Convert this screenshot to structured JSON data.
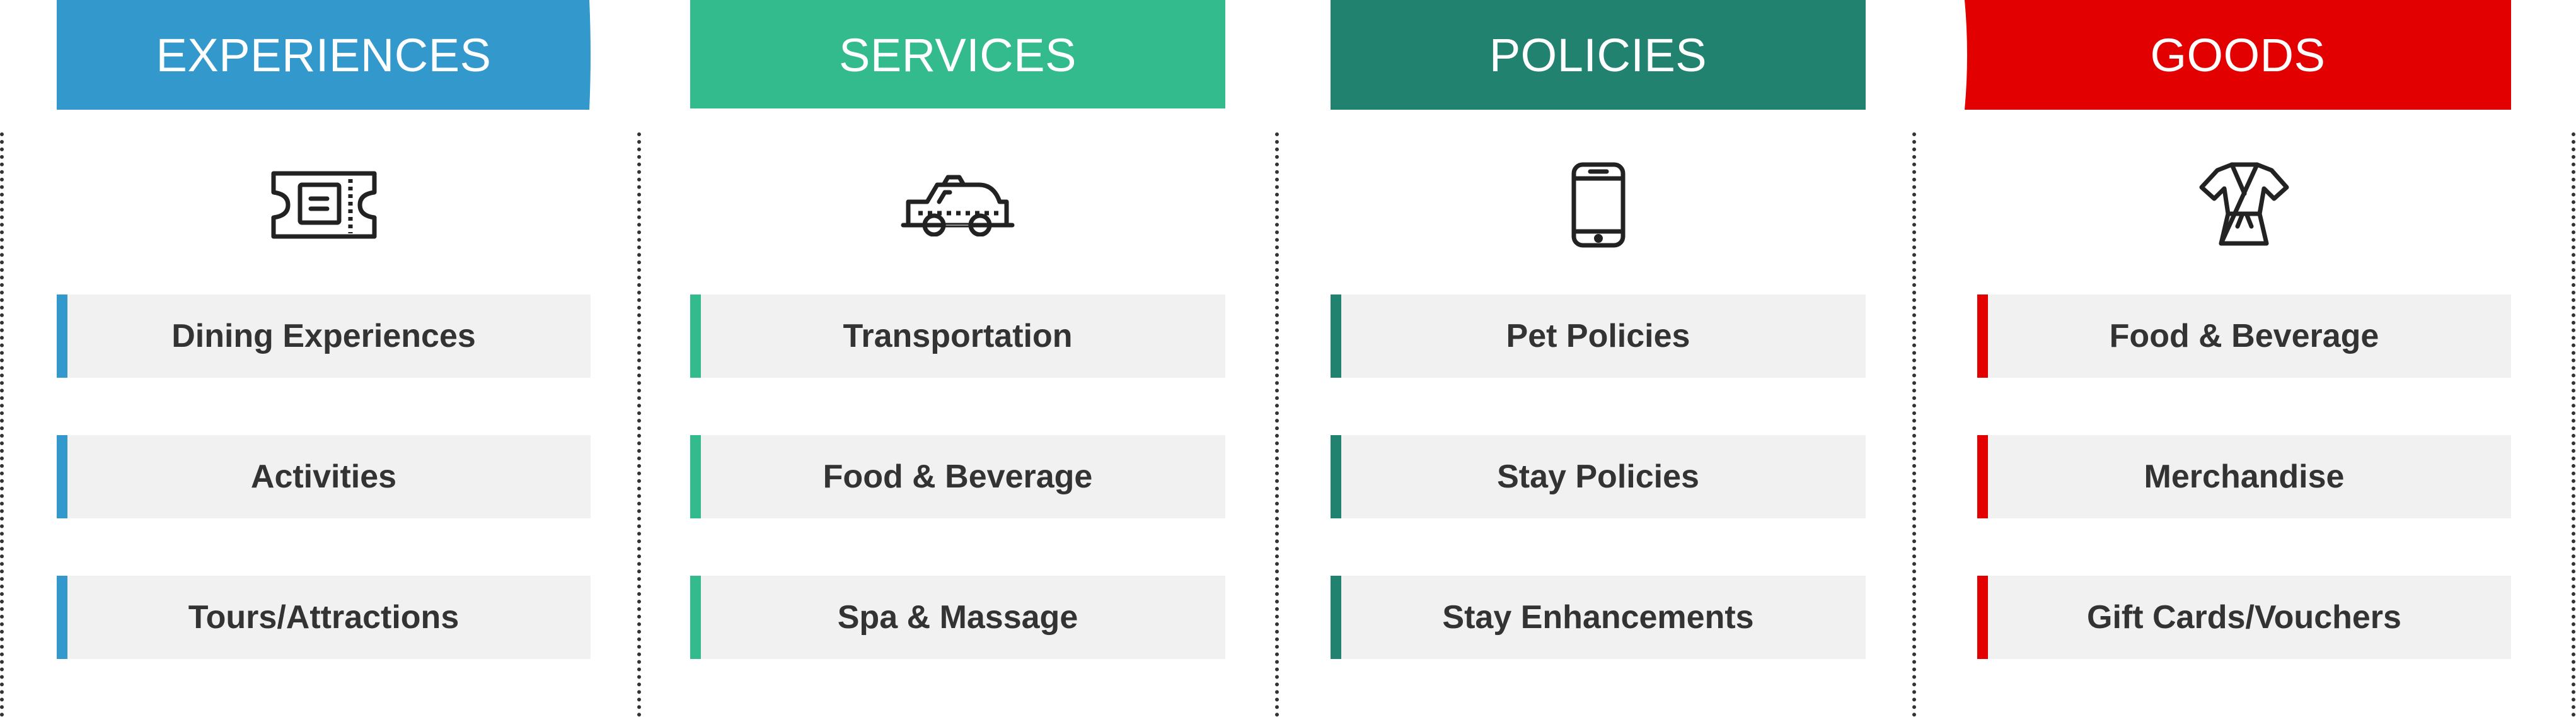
{
  "columns": [
    {
      "title": "EXPERIENCES",
      "color": "#3399cc",
      "icon": "ticket-icon",
      "items": [
        "Dining Experiences",
        "Activities",
        "Tours/Attractions"
      ]
    },
    {
      "title": "SERVICES",
      "color": "#33bb8e",
      "icon": "taxi-icon",
      "items": [
        "Transportation",
        "Food & Beverage",
        "Spa & Massage"
      ]
    },
    {
      "title": "POLICIES",
      "color": "#228270",
      "icon": "smartphone-icon",
      "items": [
        "Pet Policies",
        "Stay Policies",
        "Stay Enhancements"
      ]
    },
    {
      "title": "GOODS",
      "color": "#e30000",
      "icon": "robe-icon",
      "items": [
        "Food & Beverage",
        "Merchandise",
        "Gift Cards/Vouchers"
      ]
    }
  ]
}
